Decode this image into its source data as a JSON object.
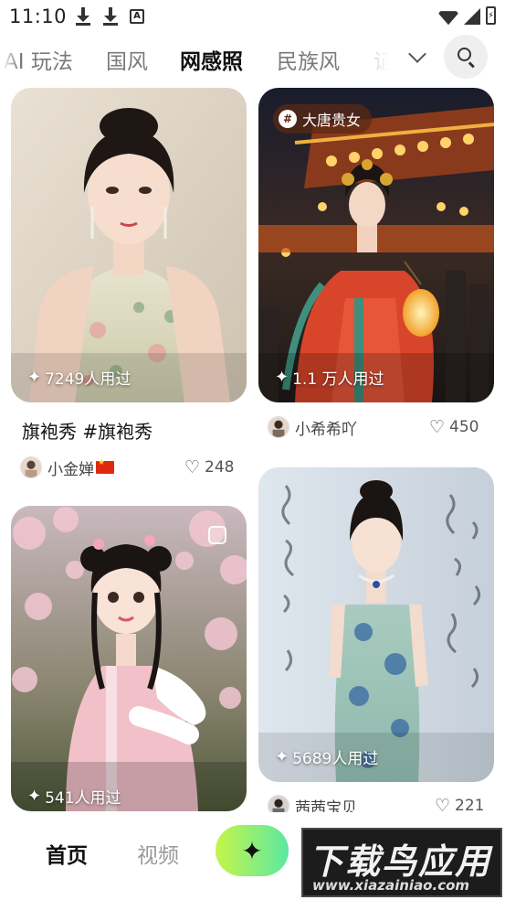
{
  "status_bar": {
    "time": "11:10",
    "battery": "⚡"
  },
  "tabs": [
    {
      "label": "AI 玩法",
      "active": false
    },
    {
      "label": "国风",
      "active": false
    },
    {
      "label": "网感照",
      "active": true
    },
    {
      "label": "民族风",
      "active": false
    },
    {
      "label": "证",
      "active": false
    }
  ],
  "feed": {
    "cards": [
      {
        "used": "7249人用过",
        "title": "旗袍秀 #旗袍秀",
        "author": "小金婵",
        "likes": "248"
      },
      {
        "tag": "大唐贵女",
        "used": "1.1 万人用过",
        "author": "小希希吖",
        "likes": "450"
      },
      {
        "used": "541人用过"
      },
      {
        "used": "5689人用过",
        "author": "茜茜宝贝",
        "likes": "221"
      }
    ]
  },
  "bottom_nav": {
    "home": "首页",
    "video": "视频",
    "create_icon": "✦"
  },
  "watermark": {
    "title": "下载鸟应用",
    "url": "www.xiazainiao.com"
  },
  "icons": {
    "sparkle": "✦",
    "heart": "♡",
    "hash": "#"
  },
  "colors": {
    "active_tab_highlight": "#c7f464",
    "create_gradient_start": "#c5f54a",
    "create_gradient_end": "#5ce8a0"
  }
}
